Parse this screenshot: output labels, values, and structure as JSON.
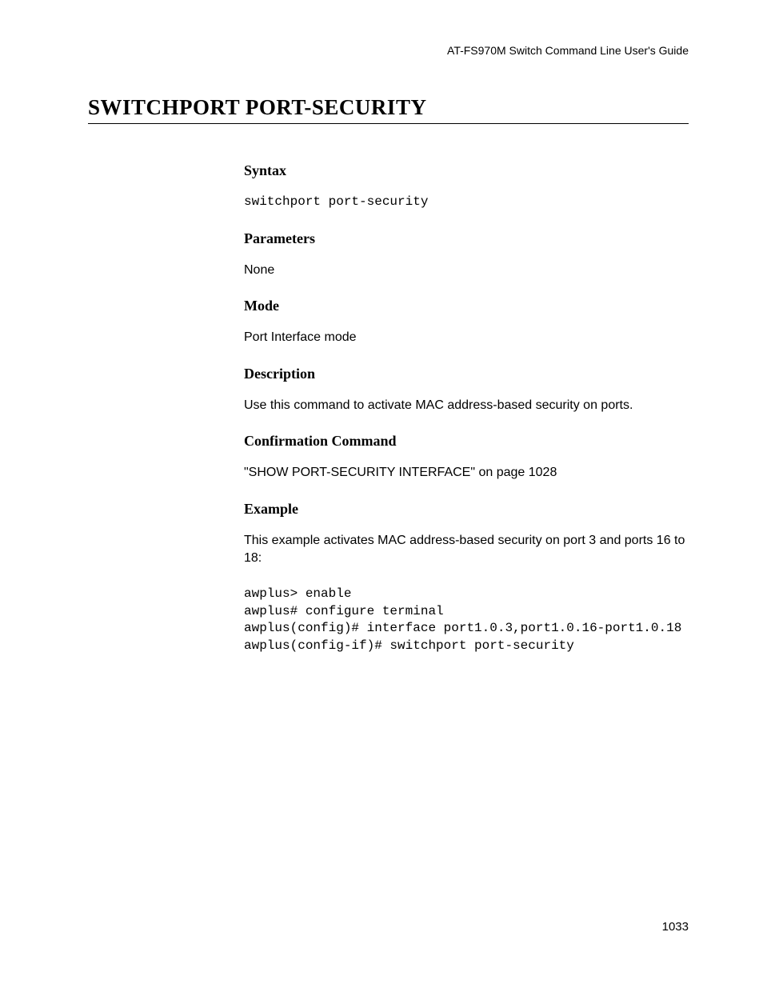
{
  "header": {
    "guide_title": "AT-FS970M Switch Command Line User's Guide"
  },
  "title": "SWITCHPORT PORT-SECURITY",
  "sections": {
    "syntax": {
      "heading": "Syntax",
      "content": "switchport port-security"
    },
    "parameters": {
      "heading": "Parameters",
      "content": "None"
    },
    "mode": {
      "heading": "Mode",
      "content": "Port Interface mode"
    },
    "description": {
      "heading": "Description",
      "content": "Use this command to activate MAC address-based security on ports."
    },
    "confirmation": {
      "heading": "Confirmation Command",
      "content": "\"SHOW PORT-SECURITY INTERFACE\" on page 1028"
    },
    "example": {
      "heading": "Example",
      "intro": "This example activates MAC address-based security on port 3 and ports 16 to 18:",
      "code": "awplus> enable\nawplus# configure terminal\nawplus(config)# interface port1.0.3,port1.0.16-port1.0.18\nawplus(config-if)# switchport port-security"
    }
  },
  "page_number": "1033"
}
